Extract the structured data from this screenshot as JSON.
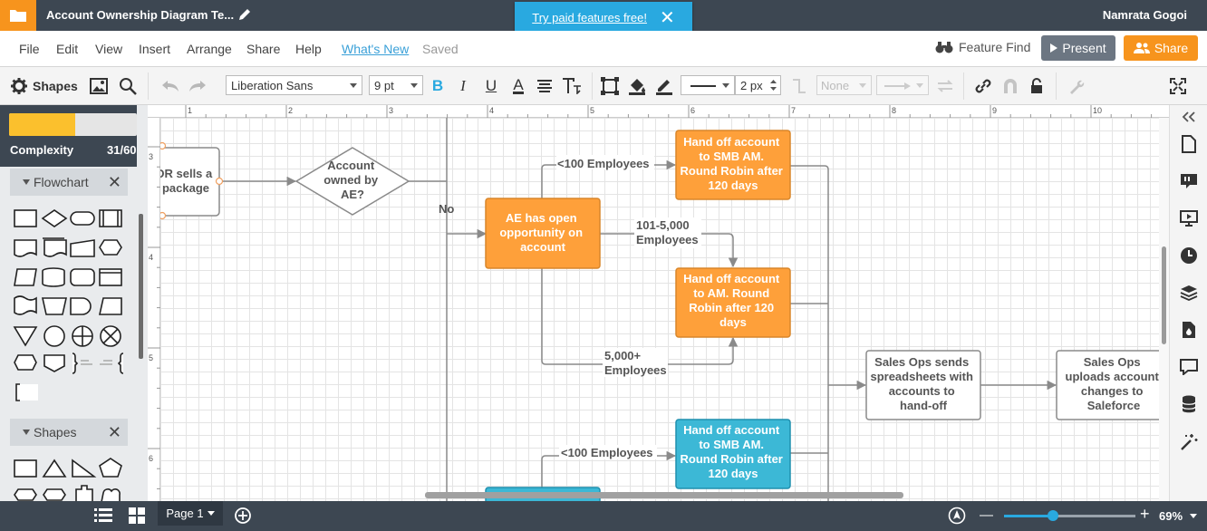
{
  "header": {
    "doc_title": "Account Ownership Diagram Te...",
    "promo_text": "Try paid features free!",
    "promo_close": "✕",
    "username": "Namrata Gogoi"
  },
  "menu": {
    "items": [
      "File",
      "Edit",
      "View",
      "Insert",
      "Arrange",
      "Share",
      "Help"
    ],
    "whats_new": "What's New",
    "saved": "Saved",
    "feature_find": "Feature Find",
    "present": "Present",
    "share": "Share"
  },
  "toolbar": {
    "shapes_label": "Shapes",
    "font": "Liberation Sans",
    "font_size": "9 pt",
    "line_width": "2 px",
    "endpoint_none": "None"
  },
  "sidebar": {
    "complexity_label": "Complexity",
    "complexity_value": "31/60",
    "complexity_fraction": 0.52,
    "section_flowchart": "Flowchart",
    "section_shapes": "Shapes"
  },
  "canvas": {
    "ruler_top": [
      "1",
      "2",
      "3",
      "4",
      "5",
      "6",
      "7",
      "8",
      "9",
      "10"
    ],
    "ruler_left": [
      "3",
      "4",
      "5",
      "6"
    ],
    "nodes": {
      "sdr": "DR sells a\npackage",
      "decision": "Account\nowned by\nAE?",
      "ae_open": "AE has open\nopportunity on\naccount",
      "handoff_smb1": "Hand off account\nto SMB AM.\nRound Robin after\n120 days",
      "handoff_am": "Hand off account\nto AM. Round\nRobin after 120\ndays",
      "handoff_smb2": "Hand off account\nto SMB AM.\nRound Robin after\n120 days",
      "salesops_send": "Sales Ops sends\nspreadsheets with\naccounts to\nhand-off",
      "salesops_upload": "Sales Ops\nuploads account\nchanges to\nSaleforce"
    },
    "edge_labels": {
      "no": "No",
      "lt100_a": "<100 Employees",
      "mid": "101-5,000\nEmployees",
      "gt5000": "5,000+\nEmployees",
      "lt100_b": "<100 Employees"
    }
  },
  "bottom": {
    "page_label": "Page 1",
    "zoom_minus": "—",
    "zoom_plus": "+",
    "zoom_value": "69%",
    "zoom_fraction": 0.37
  },
  "colors": {
    "orange": "#f7941d",
    "node_orange": "#fea03a",
    "node_blue": "#3cb8d6",
    "accent_blue": "#29a9e0",
    "dark": "#3d4752"
  }
}
